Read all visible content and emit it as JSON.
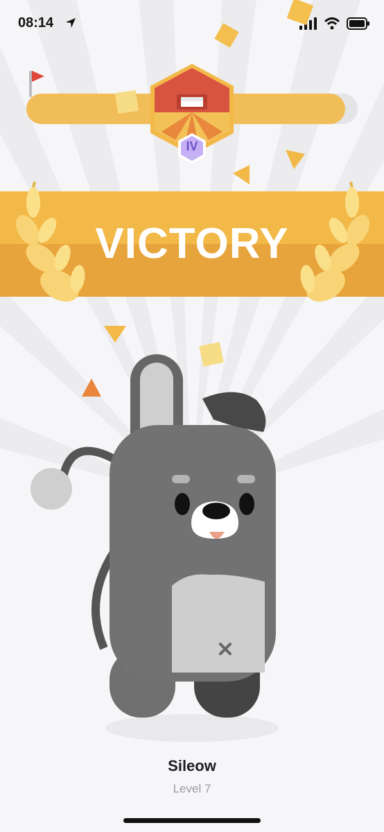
{
  "status_bar": {
    "time": "08:14",
    "icons": [
      "location-arrow-icon",
      "signal-icon",
      "wifi-icon",
      "battery-icon"
    ]
  },
  "progress": {
    "level_badge": "IV",
    "fill_fraction": 0.96,
    "start_icon": "flag-icon",
    "badge_icon": "hut-icon"
  },
  "banner": {
    "title": "VICTORY",
    "decoration": "laurel-wreath"
  },
  "character": {
    "name": "Sileow",
    "level": "Level 7"
  },
  "colors": {
    "gold": "#f1bd59",
    "banner": "#f2b948",
    "badge_red": "#d9543f",
    "badge_purple": "#b9a0f2",
    "character_body": "#707070"
  }
}
